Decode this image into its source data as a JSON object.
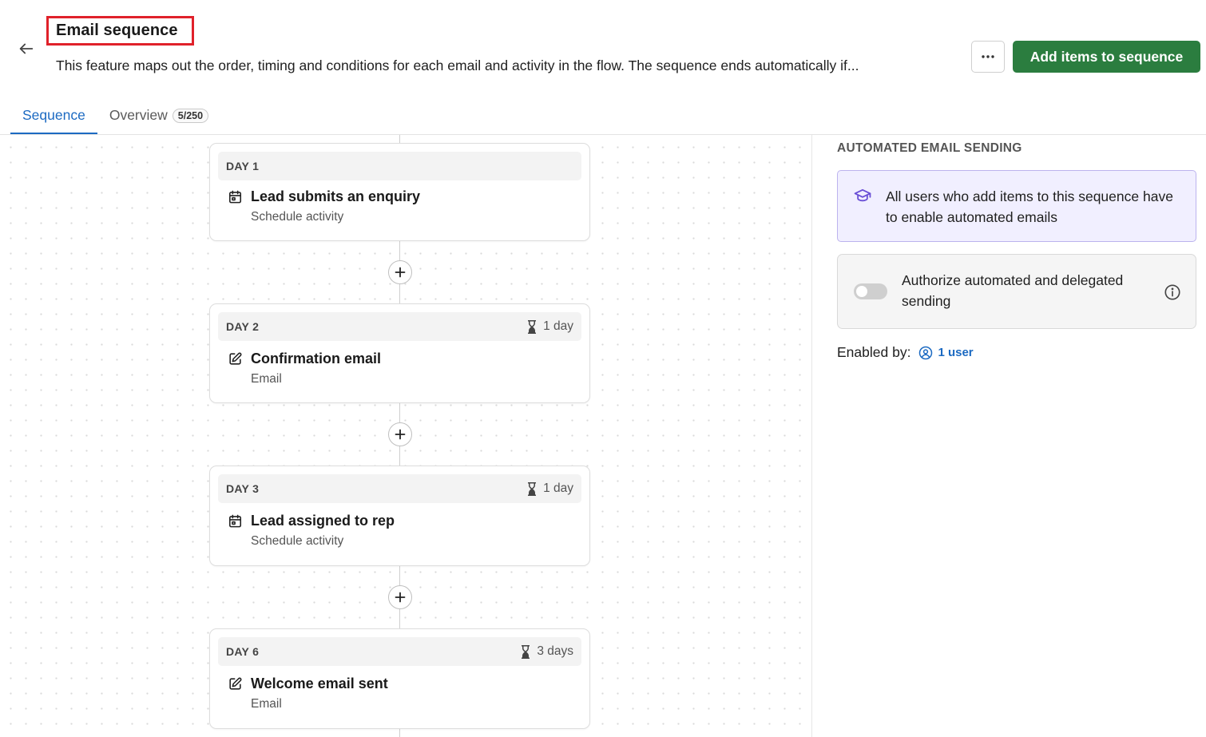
{
  "header": {
    "title": "Email sequence",
    "description": "This feature maps out the order, timing and conditions for each email and activity in the flow. The sequence ends automatically if...",
    "more_label": "···",
    "primary_action": "Add items to sequence"
  },
  "tabs": [
    {
      "label": "Sequence"
    },
    {
      "label": "Overview",
      "badge": "5/250"
    }
  ],
  "steps": [
    {
      "day": "DAY 1",
      "delay": "",
      "icon": "calendar-icon",
      "title": "Lead submits an enquiry",
      "subtitle": "Schedule activity"
    },
    {
      "day": "DAY 2",
      "delay": "1 day",
      "icon": "edit-icon",
      "title": "Confirmation email",
      "subtitle": "Email"
    },
    {
      "day": "DAY 3",
      "delay": "1 day",
      "icon": "calendar-icon",
      "title": "Lead assigned to rep",
      "subtitle": "Schedule activity"
    },
    {
      "day": "DAY 6",
      "delay": "3 days",
      "icon": "edit-icon",
      "title": "Welcome email sent",
      "subtitle": "Email"
    }
  ],
  "panel": {
    "heading": "AUTOMATED EMAIL SENDING",
    "info_text": "All users who add items to this sequence have to enable automated emails",
    "auth_text": "Authorize automated and delegated sending",
    "enabled_label": "Enabled by:",
    "enabled_value": "1 user"
  },
  "colors": {
    "primary": "#2b7d3f",
    "link": "#1c6ac2",
    "highlight": "#e0212a",
    "info_bg": "#f1efff"
  }
}
